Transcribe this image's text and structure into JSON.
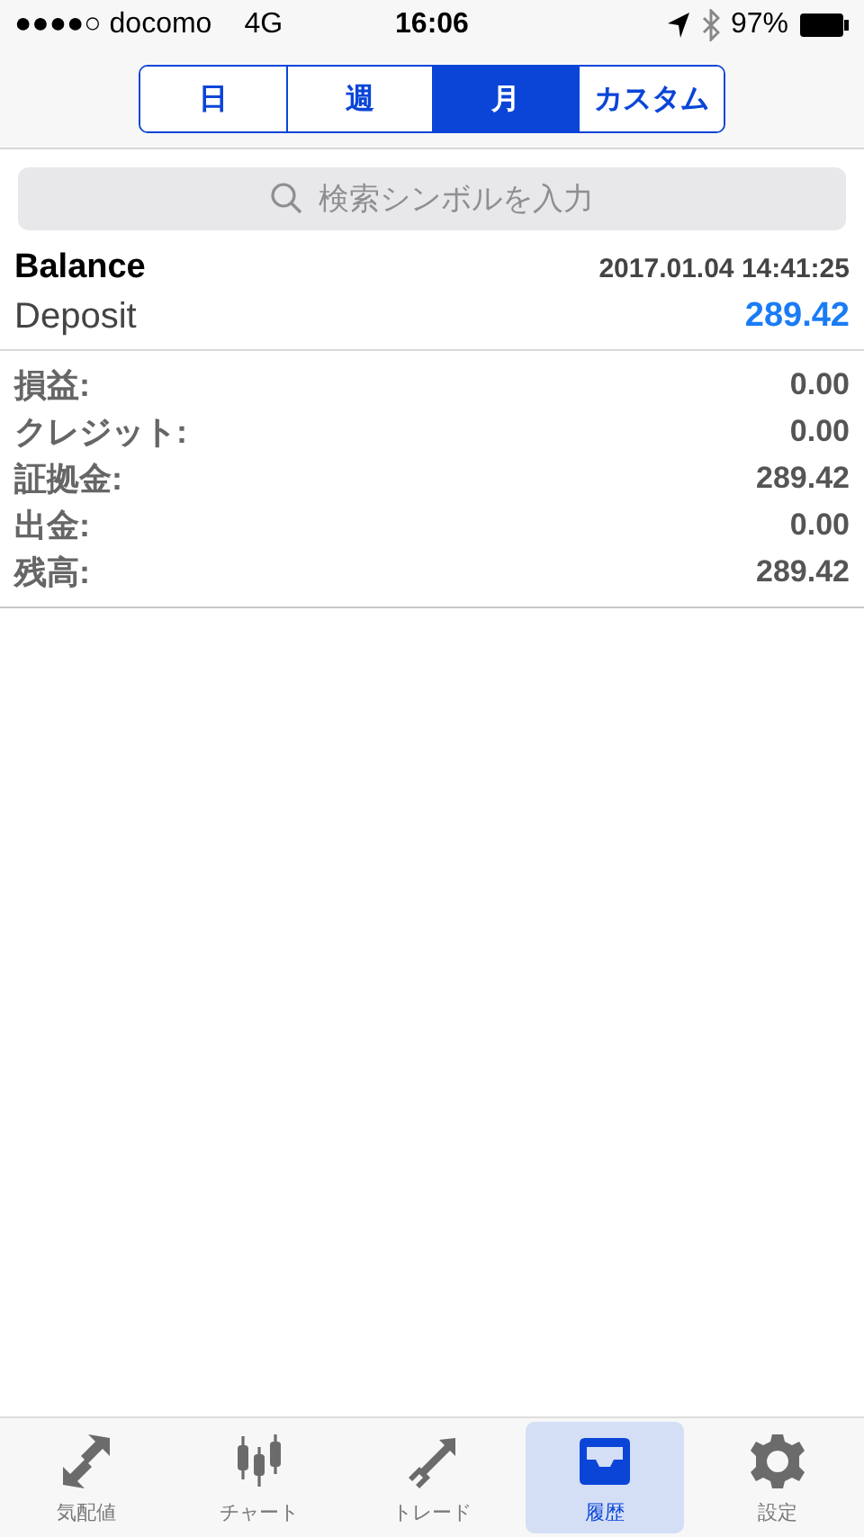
{
  "status_bar": {
    "carrier": "●●●●○ docomo",
    "network": "4G",
    "time": "16:06",
    "battery": "97%"
  },
  "period_tabs": [
    {
      "label": "日",
      "selected": false
    },
    {
      "label": "週",
      "selected": false
    },
    {
      "label": "月",
      "selected": true
    },
    {
      "label": "カスタム",
      "selected": false
    }
  ],
  "search": {
    "placeholder": "検索シンボルを入力"
  },
  "deal": {
    "title": "Balance",
    "time": "2017.01.04 14:41:25",
    "type": "Deposit",
    "amount": "289.42"
  },
  "summary": [
    {
      "label": "損益:",
      "value": "0.00"
    },
    {
      "label": "クレジット:",
      "value": "0.00"
    },
    {
      "label": "証拠金:",
      "value": "289.42"
    },
    {
      "label": "出金:",
      "value": "0.00"
    },
    {
      "label": "残高:",
      "value": "289.42"
    }
  ],
  "tab_bar": [
    {
      "kind": "quotes",
      "label": "気配値",
      "selected": false
    },
    {
      "kind": "chart",
      "label": "チャート",
      "selected": false
    },
    {
      "kind": "trade",
      "label": "トレード",
      "selected": false
    },
    {
      "kind": "history",
      "label": "履歴",
      "selected": true
    },
    {
      "kind": "settings",
      "label": "設定",
      "selected": false
    }
  ]
}
